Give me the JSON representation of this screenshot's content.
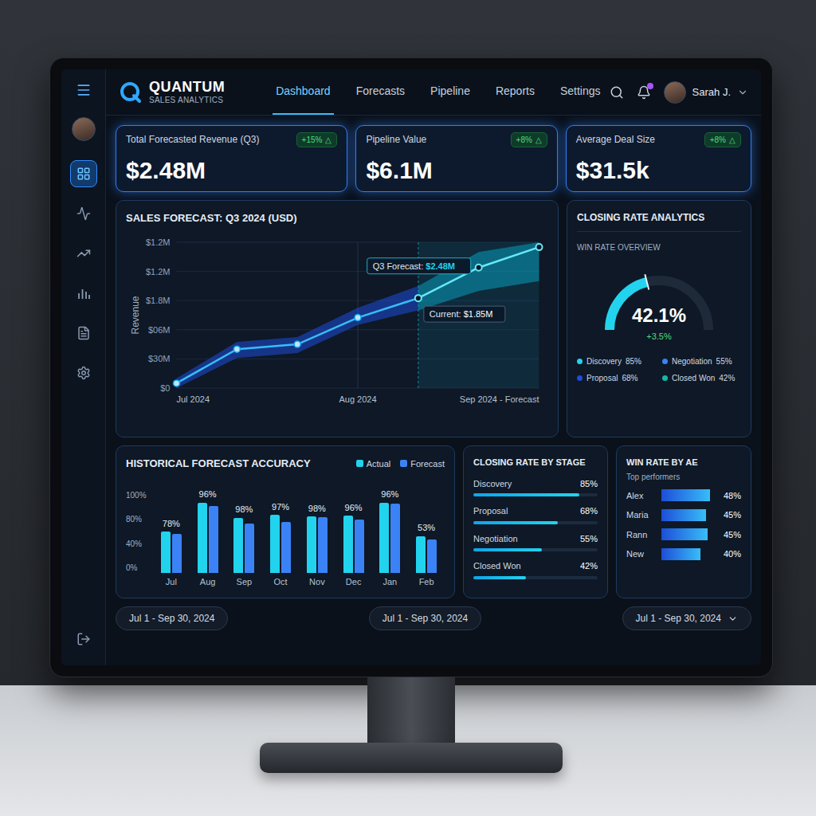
{
  "app": {
    "logo_title": "QUANTUM",
    "logo_subtitle": "SALES ANALYTICS"
  },
  "nav": {
    "tabs": [
      {
        "label": "Dashboard",
        "selected": true
      },
      {
        "label": "Forecasts",
        "selected": false
      },
      {
        "label": "Pipeline",
        "selected": false
      },
      {
        "label": "Reports",
        "selected": false
      },
      {
        "label": "Settings",
        "selected": false
      }
    ],
    "user": "Sarah J.",
    "notifications": true
  },
  "sidebar": {
    "items": [
      {
        "selected": true
      },
      {
        "selected": false
      },
      {
        "selected": false
      },
      {
        "selected": false
      },
      {
        "selected": false
      },
      {
        "selected": false
      }
    ]
  },
  "kpis": [
    {
      "label": "Total Forecasted Revenue (Q3)",
      "value": "$2.48M",
      "delta": "+15%",
      "delta_icon": "△"
    },
    {
      "label": "Pipeline Value",
      "value": "$6.1M",
      "delta": "+8%",
      "delta_icon": "△"
    },
    {
      "label": "Average Deal Size",
      "value": "$31.5k",
      "delta": "+8%",
      "delta_icon": "△"
    }
  ],
  "forecast_chart": {
    "title": "SALES FORECAST: Q3 2024 (USD)",
    "y_label": "Revenue",
    "y_ticks": [
      "$1.2M",
      "$1.2M",
      "$1.8M",
      "$06M",
      "$30M",
      "$0"
    ],
    "x_ticks": [
      "Jul 2024",
      "Aug 2024",
      "Sep 2024 - Forecast"
    ],
    "max": 3,
    "actual": [
      0.1,
      0.8,
      0.9,
      1.45,
      1.85
    ],
    "forecast_start": 4,
    "forecast": [
      1.85,
      2.48,
      2.9
    ],
    "range_low": [
      0.0,
      0.62,
      0.72,
      1.3,
      1.6,
      2.0,
      2.2
    ],
    "range_high": [
      0.2,
      0.95,
      1.05,
      1.65,
      2.1,
      2.8,
      3.0
    ],
    "callouts": [
      {
        "label": "Q3 Forecast:",
        "value": "$2.48M"
      },
      {
        "label": "Current:",
        "value": "$1.85M"
      }
    ]
  },
  "closing": {
    "title": "CLOSING RATE ANALYTICS",
    "subtitle": "WIN RATE OVERVIEW",
    "level": 0.421,
    "value": "42.1%",
    "change": "+3.5%",
    "legend": [
      {
        "label": "Discovery",
        "value": "85%",
        "color": "#22d3ee"
      },
      {
        "label": "Negotiation",
        "value": "55%",
        "color": "#3b82f6"
      },
      {
        "label": "Proposal",
        "value": "68%",
        "color": "#1d4ed8"
      },
      {
        "label": "Closed Won",
        "value": "42%",
        "color": "#14b8a6"
      }
    ]
  },
  "accuracy": {
    "title": "HISTORICAL FORECAST ACCURACY",
    "legend": [
      {
        "label": "Actual",
        "color": "#22d3ee"
      },
      {
        "label": "Forecast",
        "color": "#3b82f6"
      }
    ],
    "y_ticks": [
      "100%",
      "80%",
      "40%",
      "0%"
    ],
    "max": 100,
    "months": [
      {
        "label": "Jul",
        "value": "78%",
        "actual": 58,
        "forecast": 55
      },
      {
        "label": "Aug",
        "value": "96%",
        "actual": 100,
        "forecast": 95
      },
      {
        "label": "Sep",
        "value": "98%",
        "actual": 78,
        "forecast": 70
      },
      {
        "label": "Oct",
        "value": "97%",
        "actual": 82,
        "forecast": 72
      },
      {
        "label": "Nov",
        "value": "98%",
        "actual": 80,
        "forecast": 79
      },
      {
        "label": "Dec",
        "value": "96%",
        "actual": 81,
        "forecast": 76
      },
      {
        "label": "Jan",
        "value": "96%",
        "actual": 100,
        "forecast": 98
      },
      {
        "label": "Feb",
        "value": "53%",
        "actual": 52,
        "forecast": 47
      }
    ]
  },
  "stages": {
    "title": "CLOSING RATE BY STAGE",
    "rows": [
      {
        "label": "Discovery",
        "value": "85%",
        "level": 0.85
      },
      {
        "label": "Proposal",
        "value": "68%",
        "level": 0.68
      },
      {
        "label": "Negotiation",
        "value": "55%",
        "level": 0.55
      },
      {
        "label": "Closed Won",
        "value": "42%",
        "level": 0.42
      }
    ]
  },
  "ae": {
    "title": "WIN RATE BY AE",
    "subtitle": "Top performers",
    "rows": [
      {
        "name": "Alex",
        "value": "48%",
        "level": 0.95
      },
      {
        "name": "Maria",
        "value": "45%",
        "level": 0.88
      },
      {
        "name": "Rann",
        "value": "45%",
        "level": 0.9
      },
      {
        "name": "New",
        "value": "40%",
        "level": 0.76
      }
    ]
  },
  "date_ranges": [
    {
      "label": "Jul 1 - Sep 30, 2024",
      "dropdown": false
    },
    {
      "label": "Jul 1 - Sep 30, 2024",
      "dropdown": false
    },
    {
      "label": "Jul 1 - Sep 30, 2024",
      "dropdown": true
    }
  ]
}
